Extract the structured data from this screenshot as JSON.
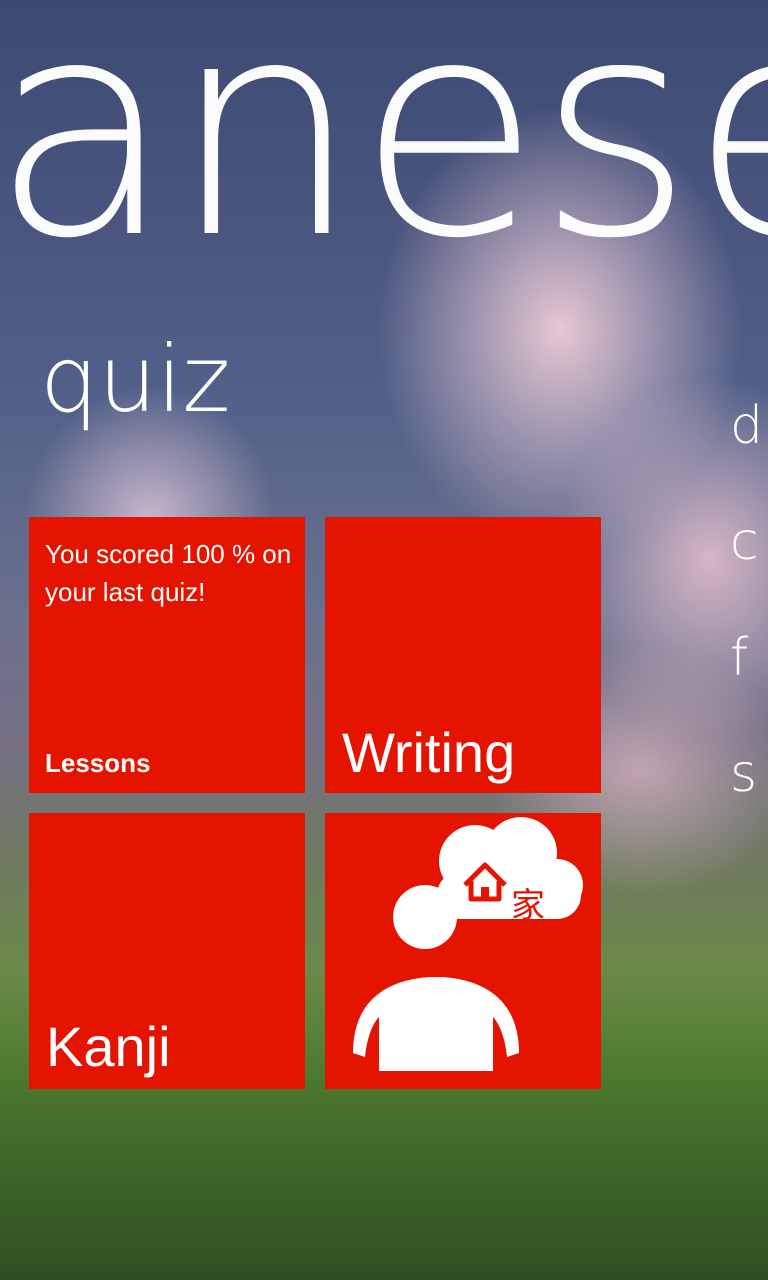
{
  "hub": {
    "title": "Japanese hub",
    "section": "quiz",
    "next_pane_items": [
      "d",
      "c",
      "f",
      "s"
    ]
  },
  "tiles": {
    "lessons": {
      "notice": "You scored 100 % on your last quiz!",
      "label": "Lessons"
    },
    "writing": {
      "label": "Writing"
    },
    "kanji": {
      "label": "Kanji"
    },
    "speaking": {
      "icon": "person-thinking-home-icon",
      "kanji_glyph": "家"
    }
  },
  "colors": {
    "tile_accent": "#e51400",
    "text": "#ffffff"
  }
}
